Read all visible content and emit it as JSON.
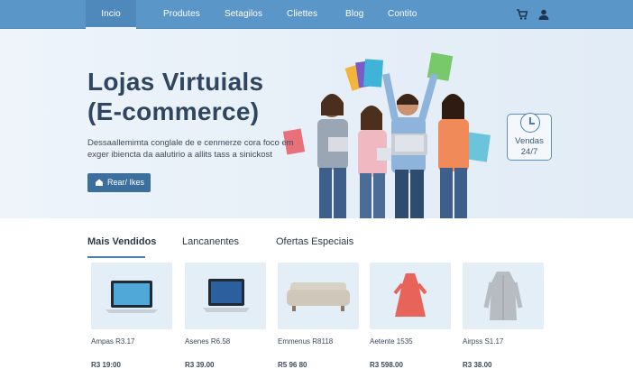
{
  "nav": {
    "items": [
      {
        "label": "Incio"
      },
      {
        "label": "Produtes"
      },
      {
        "label": "Setagilos"
      },
      {
        "label": "Cliettes"
      },
      {
        "label": "Blog"
      },
      {
        "label": "Contito"
      }
    ],
    "icons": [
      "cart-icon",
      "user-icon"
    ]
  },
  "hero": {
    "title_line1": "Lojas Virtuials",
    "title_line2": "(E-commerce)",
    "desc_line1": "Dessaallemimta conglale de e cenmerze cora foco em",
    "desc_line2": "exger ibiencta da aalutirio a allits tass a sinickost",
    "button_label": "Rear/ Ikes",
    "badge_line1": "Vendas",
    "badge_line2": "24/7"
  },
  "tabs": [
    {
      "label": "Mais Vendidos",
      "active": true
    },
    {
      "label": "Lancanentes",
      "active": false
    },
    {
      "label": "Ofertas Especiais",
      "active": false
    }
  ],
  "products": [
    {
      "name": "Ampas R3.17",
      "price": "R3 19:00",
      "icon": "laptop-icon"
    },
    {
      "name": "Asenes R6.58",
      "price": "R3 39.00",
      "icon": "laptop-icon"
    },
    {
      "name": "Emmenus R8118",
      "price": "R5 96 80",
      "icon": "sofa-icon"
    },
    {
      "name": "Aetente 1535",
      "price": "R3 598.00",
      "icon": "dress-icon"
    },
    {
      "name": "Airpss S1.17",
      "price": "R3 38.00",
      "icon": "coat-icon"
    }
  ],
  "colors": {
    "nav": "#5b96c8",
    "accent": "#3d6f9e",
    "hero_bg": "#e6eff8"
  }
}
